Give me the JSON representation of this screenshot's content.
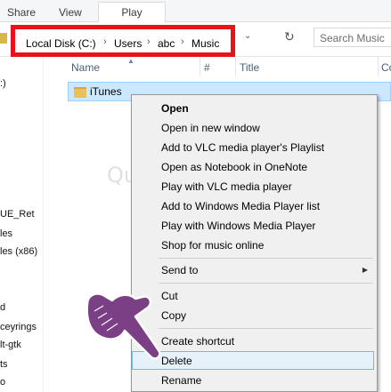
{
  "ribbon": {
    "tabs": [
      "Share",
      "View",
      "Play"
    ]
  },
  "address": {
    "segments": [
      "Local Disk (C:)",
      "Users",
      "abc",
      "Music"
    ],
    "search_placeholder": "Search Music"
  },
  "left_pane": {
    "items": [
      ":)",
      "UE_Ret",
      "les",
      "les (x86)",
      "d",
      "ceyrings",
      "lt-gtk",
      "ts",
      "o"
    ]
  },
  "columns": {
    "name": "Name",
    "num": "#",
    "title": "Title",
    "more": "Co"
  },
  "selected_item": {
    "name": "iTunes"
  },
  "watermark": "Quantrimang",
  "context_menu": {
    "items": [
      "Open",
      "Open in new window",
      "Add to VLC media player's Playlist",
      "Open as Notebook in OneNote",
      "Play with VLC media player",
      "Add to Windows Media Player list",
      "Play with Windows Media Player",
      "Shop for music online",
      "Send to",
      "Cut",
      "Copy",
      "Create shortcut",
      "Delete",
      "Rename"
    ]
  },
  "colors": {
    "highlight": "#e8121a",
    "selection": "#cce8ff",
    "menu_hover": "#e5f1fb"
  }
}
